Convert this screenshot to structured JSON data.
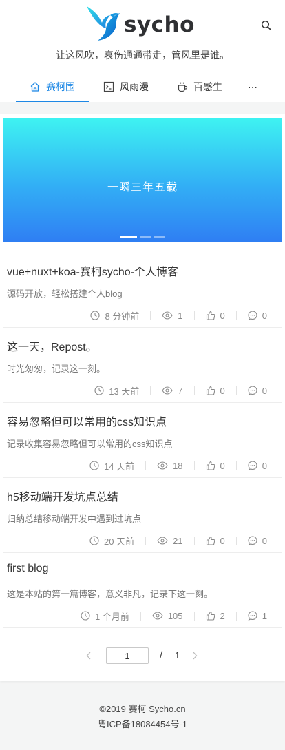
{
  "header": {
    "logo_text": "sycho",
    "tagline": "让这风吹，哀伤通通带走，管风里是谁。"
  },
  "nav": {
    "items": [
      {
        "label": "赛柯围",
        "icon": "home-icon",
        "active": true
      },
      {
        "label": "风雨漫",
        "icon": "terminal-icon",
        "active": false
      },
      {
        "label": "百感生",
        "icon": "coffee-icon",
        "active": false
      }
    ],
    "more_label": "···"
  },
  "colors": {
    "accent": "#1e88e5",
    "banner_top": "#3ef2f2",
    "banner_bottom": "#2f7ef3"
  },
  "banner": {
    "text": "一瞬三年五载",
    "slide_count": 3,
    "active_slide": 0
  },
  "posts": [
    {
      "title": "vue+nuxt+koa-赛柯sycho-个人博客",
      "desc": "源码开放，轻松搭建个人blog",
      "time": "8 分钟前",
      "views": "1",
      "likes": "0",
      "comments": "0"
    },
    {
      "title": "这一天，Repost。",
      "desc": "时光匆匆，记录这一刻。",
      "time": "13 天前",
      "views": "7",
      "likes": "0",
      "comments": "0"
    },
    {
      "title": "容易忽略但可以常用的css知识点",
      "desc": "记录收集容易忽略但可以常用的css知识点",
      "time": "14 天前",
      "views": "18",
      "likes": "0",
      "comments": "0"
    },
    {
      "title": "h5移动端开发坑点总结",
      "desc": "归纳总结移动端开发中遇到过坑点",
      "time": "20 天前",
      "views": "21",
      "likes": "0",
      "comments": "0"
    },
    {
      "title": "first blog",
      "desc": "这是本站的第一篇博客，意义非凡，记录下这一刻。",
      "time": "1 个月前",
      "views": "105",
      "likes": "2",
      "comments": "1"
    }
  ],
  "pagination": {
    "current": "1",
    "slash": "/",
    "total": "1"
  },
  "footer": {
    "line1": "©2019 赛柯 Sycho.cn",
    "line2": "粤ICP备18084454号-1"
  }
}
